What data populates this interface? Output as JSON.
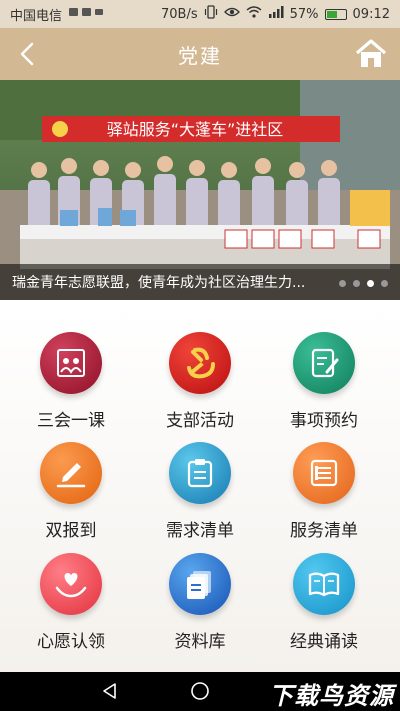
{
  "status": {
    "carrier": "中国电信",
    "speed": "70B/s",
    "battery": "57%",
    "battery_level": 0.57,
    "time": "09:12"
  },
  "header": {
    "title": "党建",
    "back_icon": "chevron-left-icon",
    "home_icon": "home-icon"
  },
  "banner": {
    "banner_text": "驿站服务“大蓬车”进社区",
    "caption": "瑞金青年志愿联盟，使青年成为社区治理生力...",
    "slide_count": 4,
    "active_slide": 3
  },
  "menu": {
    "items": [
      {
        "label": "三会一课",
        "icon": "meeting-board-icon",
        "color": "#a3152f"
      },
      {
        "label": "支部活动",
        "icon": "party-emblem-icon",
        "color": "#d1201a"
      },
      {
        "label": "事项预约",
        "icon": "note-edit-icon",
        "color": "#169069"
      },
      {
        "label": "双报到",
        "icon": "sign-pen-icon",
        "color": "#f07a2a"
      },
      {
        "label": "需求清单",
        "icon": "clipboard-icon",
        "color": "#1f88c2"
      },
      {
        "label": "服务清单",
        "icon": "list-doc-icon",
        "color": "#f07a2a"
      },
      {
        "label": "心愿认领",
        "icon": "heart-hand-icon",
        "color": "#ec4750"
      },
      {
        "label": "资料库",
        "icon": "stack-docs-icon",
        "color": "#2b6fcf"
      },
      {
        "label": "经典诵读",
        "icon": "open-book-icon",
        "color": "#1aa0d6"
      }
    ]
  },
  "navbar": {
    "watermark": "下载鸟资源"
  }
}
